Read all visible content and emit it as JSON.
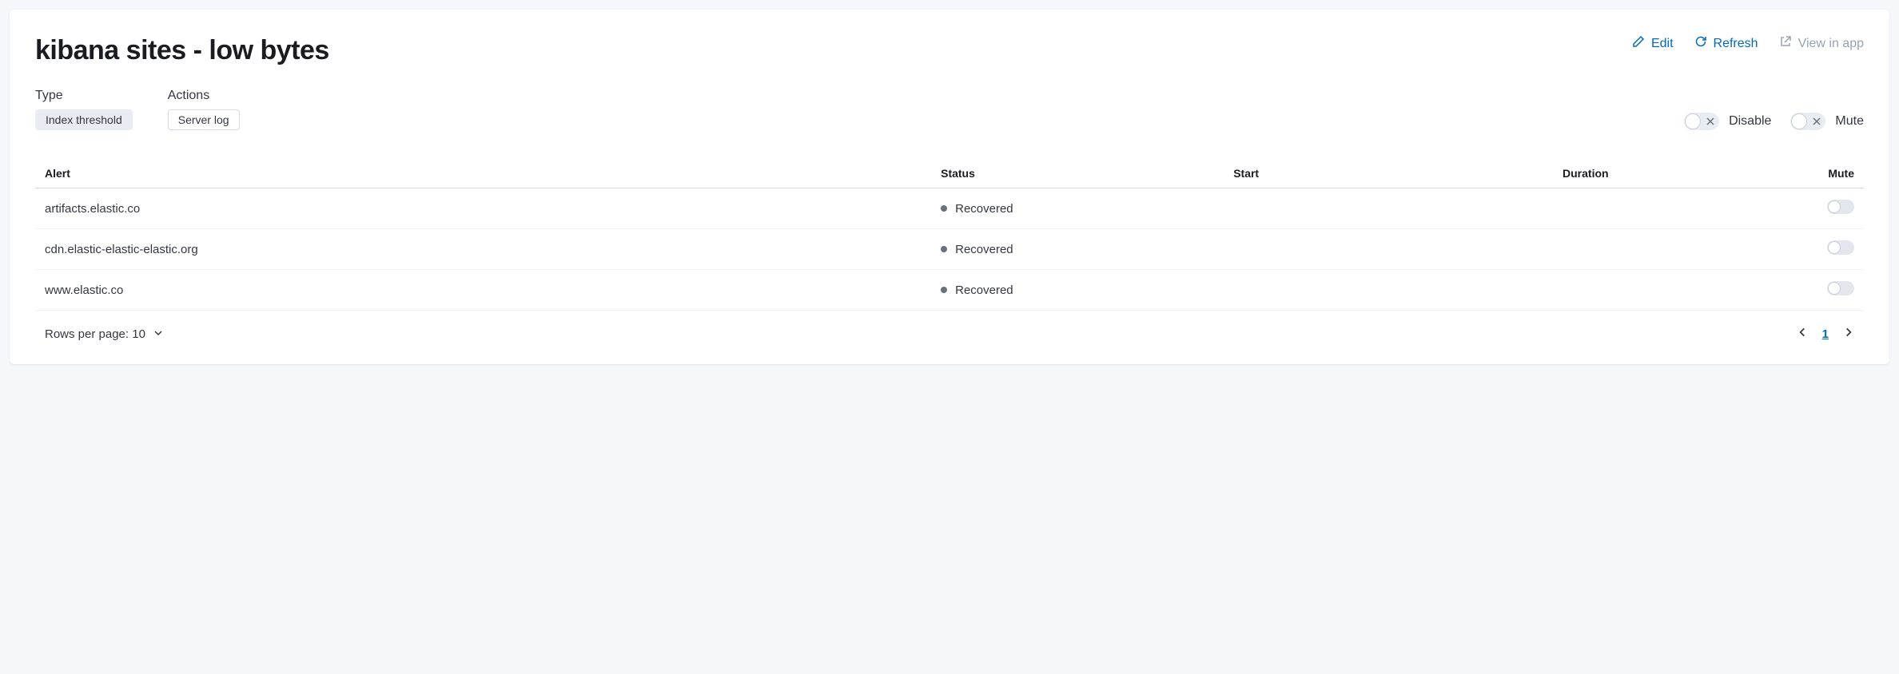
{
  "title": "kibana sites - low bytes",
  "header_actions": {
    "edit": "Edit",
    "refresh": "Refresh",
    "view_in_app": "View in app"
  },
  "meta": {
    "type": {
      "label": "Type",
      "value": "Index threshold"
    },
    "actions": {
      "label": "Actions",
      "value": "Server log"
    }
  },
  "toggles": {
    "disable": "Disable",
    "mute": "Mute"
  },
  "table": {
    "columns": {
      "alert": "Alert",
      "status": "Status",
      "start": "Start",
      "duration": "Duration",
      "mute": "Mute"
    },
    "rows": [
      {
        "alert": "artifacts.elastic.co",
        "status": "Recovered",
        "start": "",
        "duration": ""
      },
      {
        "alert": "cdn.elastic-elastic-elastic.org",
        "status": "Recovered",
        "start": "",
        "duration": ""
      },
      {
        "alert": "www.elastic.co",
        "status": "Recovered",
        "start": "",
        "duration": ""
      }
    ]
  },
  "pagination": {
    "rows_per_page_label": "Rows per page: 10",
    "current_page": "1"
  }
}
